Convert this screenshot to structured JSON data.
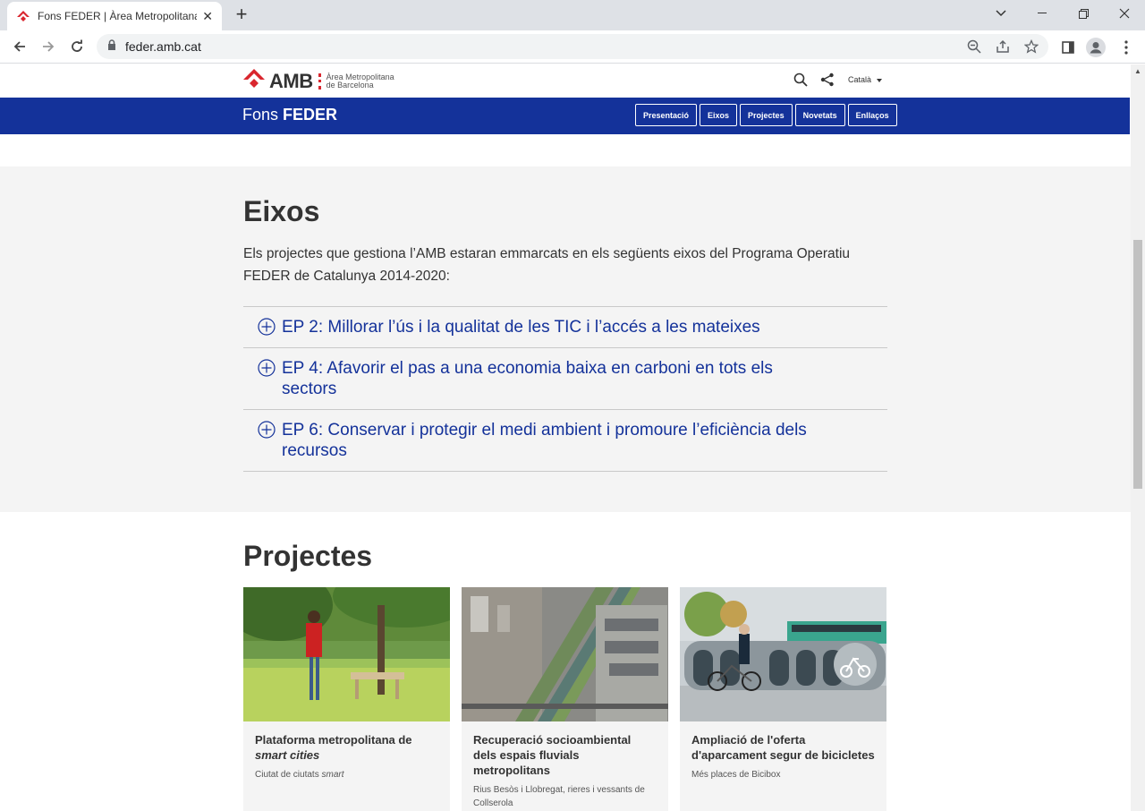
{
  "browser": {
    "tab_title": "Fons FEDER | Àrea Metropolitana",
    "url": "feder.amb.cat"
  },
  "header": {
    "logo_text": "AMB",
    "logo_sub1": "Àrea Metropolitana",
    "logo_sub2": "de Barcelona",
    "language": "Català"
  },
  "bluebar": {
    "brand_prefix": "Fons ",
    "brand_bold": "FEDER",
    "menu": [
      "Presentació",
      "Eixos",
      "Projectes",
      "Novetats",
      "Enllaços"
    ]
  },
  "eixos": {
    "title": "Eixos",
    "intro": "Els projectes que gestiona l’AMB estaran emmarcats en els següents eixos del Programa Operatiu FEDER de Catalunya 2014-2020:",
    "items": [
      "EP 2: Millorar l’ús i la qualitat de les TIC i l’accés a les mateixes",
      "EP 4: Afavorir el pas a una economia baixa en carboni en tots els sectors",
      "EP 6: Conservar i protegir el medi ambient i promoure l’eficiència dels recursos"
    ]
  },
  "projectes": {
    "title": "Projectes",
    "cards": [
      {
        "title": "Plataforma metropolitana de ",
        "title_em": "smart cities",
        "sub": "Ciutat de ciutats ",
        "sub_em": "smart"
      },
      {
        "title": "Recuperació socioambiental dels espais fluvials metropolitans",
        "title_em": "",
        "sub": "Rius Besòs i Llobregat, rieres i vessants de Collserola",
        "sub_em": ""
      },
      {
        "title": "Ampliació de l'oferta d'aparcament segur de bicicletes",
        "title_em": "",
        "sub": "Més places de Bicibox",
        "sub_em": ""
      }
    ]
  },
  "colors": {
    "brand_blue": "#14329a",
    "logo_red": "#d9262e",
    "grey_bg": "#f4f4f4"
  }
}
